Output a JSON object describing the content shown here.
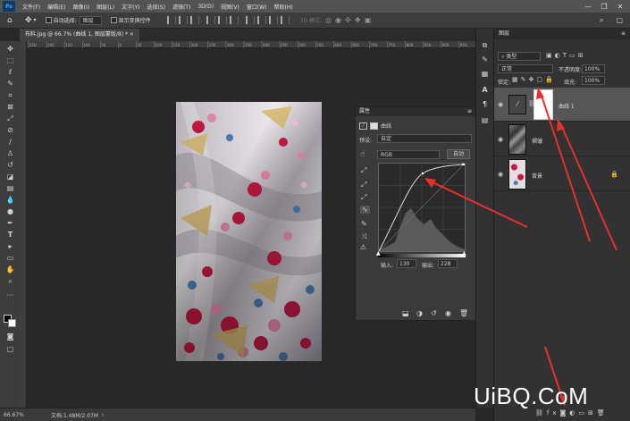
{
  "menu": {
    "app_logo": "Ps",
    "items": [
      "文件(F)",
      "编辑(E)",
      "图像(I)",
      "图层(L)",
      "文字(Y)",
      "选择(S)",
      "滤镜(T)",
      "3D(D)",
      "视图(V)",
      "窗口(W)",
      "帮助(H)"
    ],
    "window_controls": [
      "—",
      "❐",
      "✕"
    ]
  },
  "options": {
    "auto_select_label": "自动选择:",
    "auto_select_target": "图层",
    "show_transform_label": "显示变换控件",
    "mode_3d_label": "3D 模式:"
  },
  "document": {
    "tab_title": "布料.jpg @ 66.7% (曲线 1, 图层蒙版/8) *  ×",
    "ruler_ticks": [
      "250",
      "200",
      "150",
      "100",
      "50",
      "0",
      "50",
      "100",
      "150",
      "200",
      "250",
      "300",
      "350",
      "400",
      "450",
      "500",
      "550",
      "600",
      "650",
      "700",
      "750",
      "800",
      "850",
      "900",
      "950"
    ]
  },
  "status": {
    "zoom": "66.67%",
    "doc": "文档:1.48M/2.07M"
  },
  "properties": {
    "title": "属性",
    "panel_label": "曲线",
    "preset_label": "预设:",
    "preset_value": "自定",
    "channel_value": "RGB",
    "auto_button": "自动",
    "input_label": "输入:",
    "input_value": "130",
    "output_label": "输出:",
    "output_value": "228"
  },
  "layers": {
    "title": "图层",
    "filter_kind": "类型",
    "blend_mode": "正常",
    "opacity_label": "不透明度:",
    "opacity_value": "100%",
    "lock_label": "锁定:",
    "fill_label": "填充:",
    "fill_value": "100%",
    "items": [
      {
        "name": "曲线 1"
      },
      {
        "name": "褶皱"
      },
      {
        "name": "背景"
      }
    ]
  },
  "watermark": {
    "text": "UiBQ.CoM"
  },
  "colors": {
    "accent_red": "#e8302a",
    "fabric_red": "#c21a44"
  }
}
